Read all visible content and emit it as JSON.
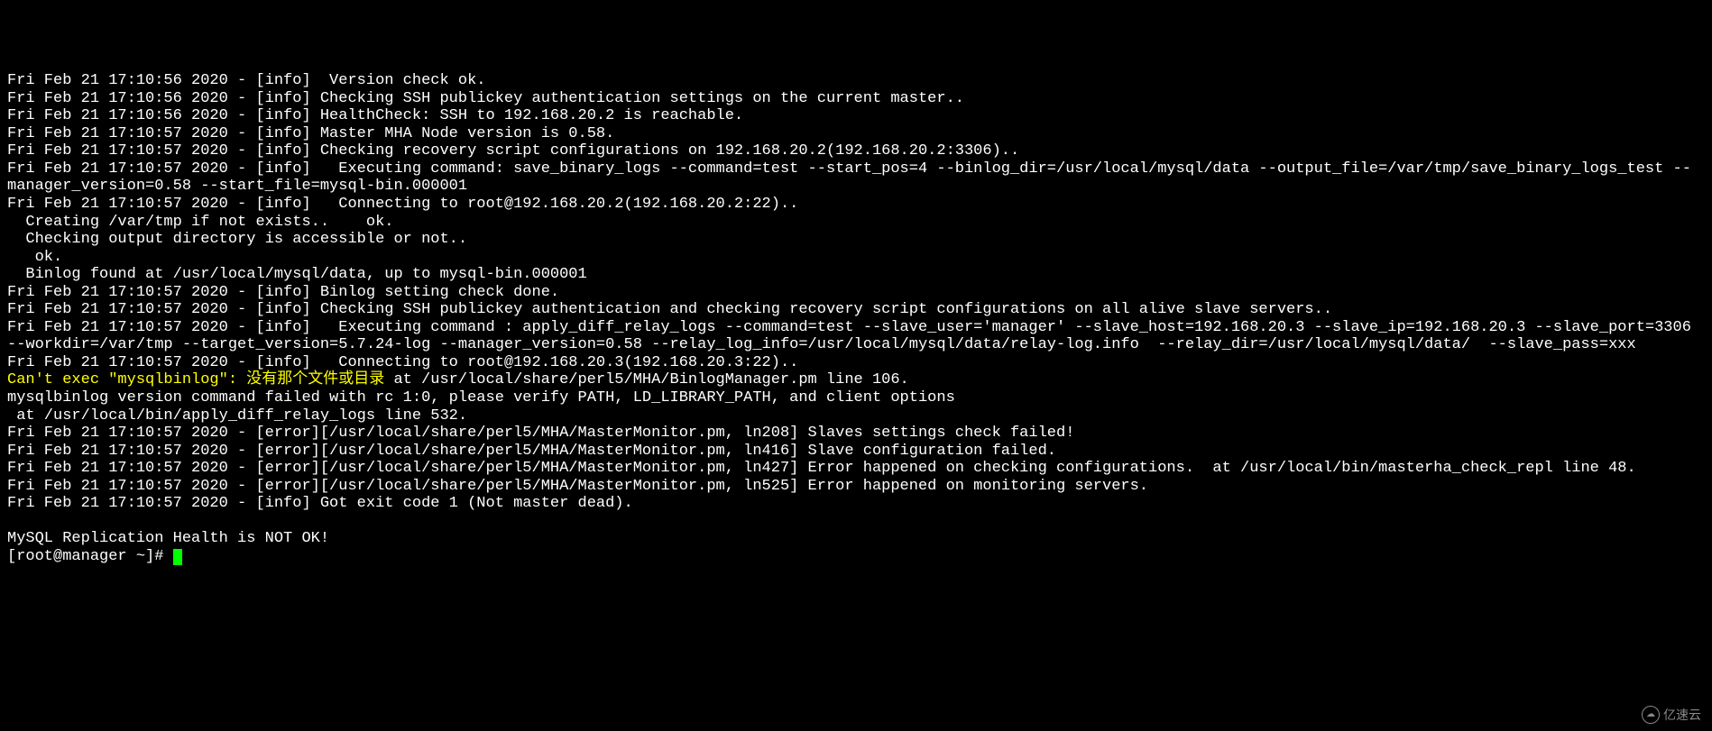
{
  "lines": [
    {
      "text": "Fri Feb 21 17:10:56 2020 - [info]  Version check ok.",
      "color": "white"
    },
    {
      "text": "Fri Feb 21 17:10:56 2020 - [info] Checking SSH publickey authentication settings on the current master..",
      "color": "white"
    },
    {
      "text": "Fri Feb 21 17:10:56 2020 - [info] HealthCheck: SSH to 192.168.20.2 is reachable.",
      "color": "white"
    },
    {
      "text": "Fri Feb 21 17:10:57 2020 - [info] Master MHA Node version is 0.58.",
      "color": "white"
    },
    {
      "text": "Fri Feb 21 17:10:57 2020 - [info] Checking recovery script configurations on 192.168.20.2(192.168.20.2:3306)..",
      "color": "white"
    },
    {
      "text": "Fri Feb 21 17:10:57 2020 - [info]   Executing command: save_binary_logs --command=test --start_pos=4 --binlog_dir=/usr/local/mysql/data --output_file=/var/tmp/save_binary_logs_test --manager_version=0.58 --start_file=mysql-bin.000001",
      "color": "white"
    },
    {
      "text": "Fri Feb 21 17:10:57 2020 - [info]   Connecting to root@192.168.20.2(192.168.20.2:22)..",
      "color": "white"
    },
    {
      "text": "  Creating /var/tmp if not exists..    ok.",
      "color": "white"
    },
    {
      "text": "  Checking output directory is accessible or not..",
      "color": "white"
    },
    {
      "text": "   ok.",
      "color": "white"
    },
    {
      "text": "  Binlog found at /usr/local/mysql/data, up to mysql-bin.000001",
      "color": "white"
    },
    {
      "text": "Fri Feb 21 17:10:57 2020 - [info] Binlog setting check done.",
      "color": "white"
    },
    {
      "text": "Fri Feb 21 17:10:57 2020 - [info] Checking SSH publickey authentication and checking recovery script configurations on all alive slave servers..",
      "color": "white"
    },
    {
      "text": "Fri Feb 21 17:10:57 2020 - [info]   Executing command : apply_diff_relay_logs --command=test --slave_user='manager' --slave_host=192.168.20.3 --slave_ip=192.168.20.3 --slave_port=3306 --workdir=/var/tmp --target_version=5.7.24-log --manager_version=0.58 --relay_log_info=/usr/local/mysql/data/relay-log.info  --relay_dir=/usr/local/mysql/data/  --slave_pass=xxx",
      "color": "white"
    },
    {
      "text": "Fri Feb 21 17:10:57 2020 - [info]   Connecting to root@192.168.20.3(192.168.20.3:22)..",
      "color": "white"
    }
  ],
  "error_line": {
    "yellow_part": "Can't exec \"mysqlbinlog\": 没有那个文件或目录",
    "white_part": " at /usr/local/share/perl5/MHA/BinlogManager.pm line 106."
  },
  "lines_after": [
    {
      "text": "mysqlbinlog version command failed with rc 1:0, please verify PATH, LD_LIBRARY_PATH, and client options",
      "color": "white"
    },
    {
      "text": " at /usr/local/bin/apply_diff_relay_logs line 532.",
      "color": "white"
    },
    {
      "text": "Fri Feb 21 17:10:57 2020 - [error][/usr/local/share/perl5/MHA/MasterMonitor.pm, ln208] Slaves settings check failed!",
      "color": "white"
    },
    {
      "text": "Fri Feb 21 17:10:57 2020 - [error][/usr/local/share/perl5/MHA/MasterMonitor.pm, ln416] Slave configuration failed.",
      "color": "white"
    },
    {
      "text": "Fri Feb 21 17:10:57 2020 - [error][/usr/local/share/perl5/MHA/MasterMonitor.pm, ln427] Error happened on checking configurations.  at /usr/local/bin/masterha_check_repl line 48.",
      "color": "white"
    },
    {
      "text": "Fri Feb 21 17:10:57 2020 - [error][/usr/local/share/perl5/MHA/MasterMonitor.pm, ln525] Error happened on monitoring servers.",
      "color": "white"
    },
    {
      "text": "Fri Feb 21 17:10:57 2020 - [info] Got exit code 1 (Not master dead).",
      "color": "white"
    },
    {
      "text": "",
      "color": "white"
    },
    {
      "text": "MySQL Replication Health is NOT OK!",
      "color": "white"
    }
  ],
  "prompt": "[root@manager ~]# ",
  "watermark": "亿速云"
}
